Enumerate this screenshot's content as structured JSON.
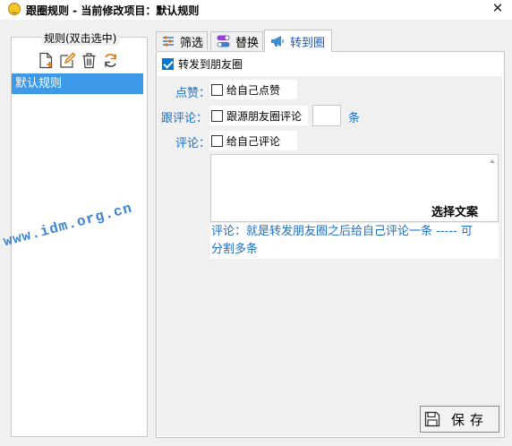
{
  "window": {
    "title": "跟圈规则 - 当前修改项目：默认规则",
    "close_glyph": "✕"
  },
  "rules": {
    "caption": "规则(双击选中)",
    "toolbar": [
      "new-rule-icon",
      "edit-rule-icon",
      "delete-rule-icon",
      "refresh-icon"
    ],
    "items": [
      "默认规则"
    ]
  },
  "tabs": [
    {
      "label": "筛选",
      "icon": "filter-icon"
    },
    {
      "label": "替换",
      "icon": "toggle-icon"
    },
    {
      "label": "转到圈",
      "icon": "megaphone-icon",
      "active": true
    }
  ],
  "forward": {
    "label": "转发到朋友圈",
    "checked": true
  },
  "like": {
    "field_label": "点赞：",
    "option_label": "给自己点赞",
    "checked": false
  },
  "follow_comment": {
    "field_label": "跟评论：",
    "option_label": "跟源朋友圈评论",
    "checked": false,
    "count_value": "",
    "unit": "条"
  },
  "comment": {
    "field_label": "评论：",
    "option_label": "给自己评论",
    "checked": false,
    "text_value": "",
    "choose_text_label": "选择文案"
  },
  "hint": {
    "line1": "评论：就是转发朋友圈之后给自己评论一条 ----- 可",
    "line2": "分割多条"
  },
  "watermark": "www.idm.org.cn",
  "save": {
    "label": "保存",
    "icon": "floppy-disk-icon"
  },
  "colors": {
    "accent_blue": "#1f6fc5",
    "selection": "#3c9ae8",
    "checkbox_checked": "#0078d7"
  }
}
